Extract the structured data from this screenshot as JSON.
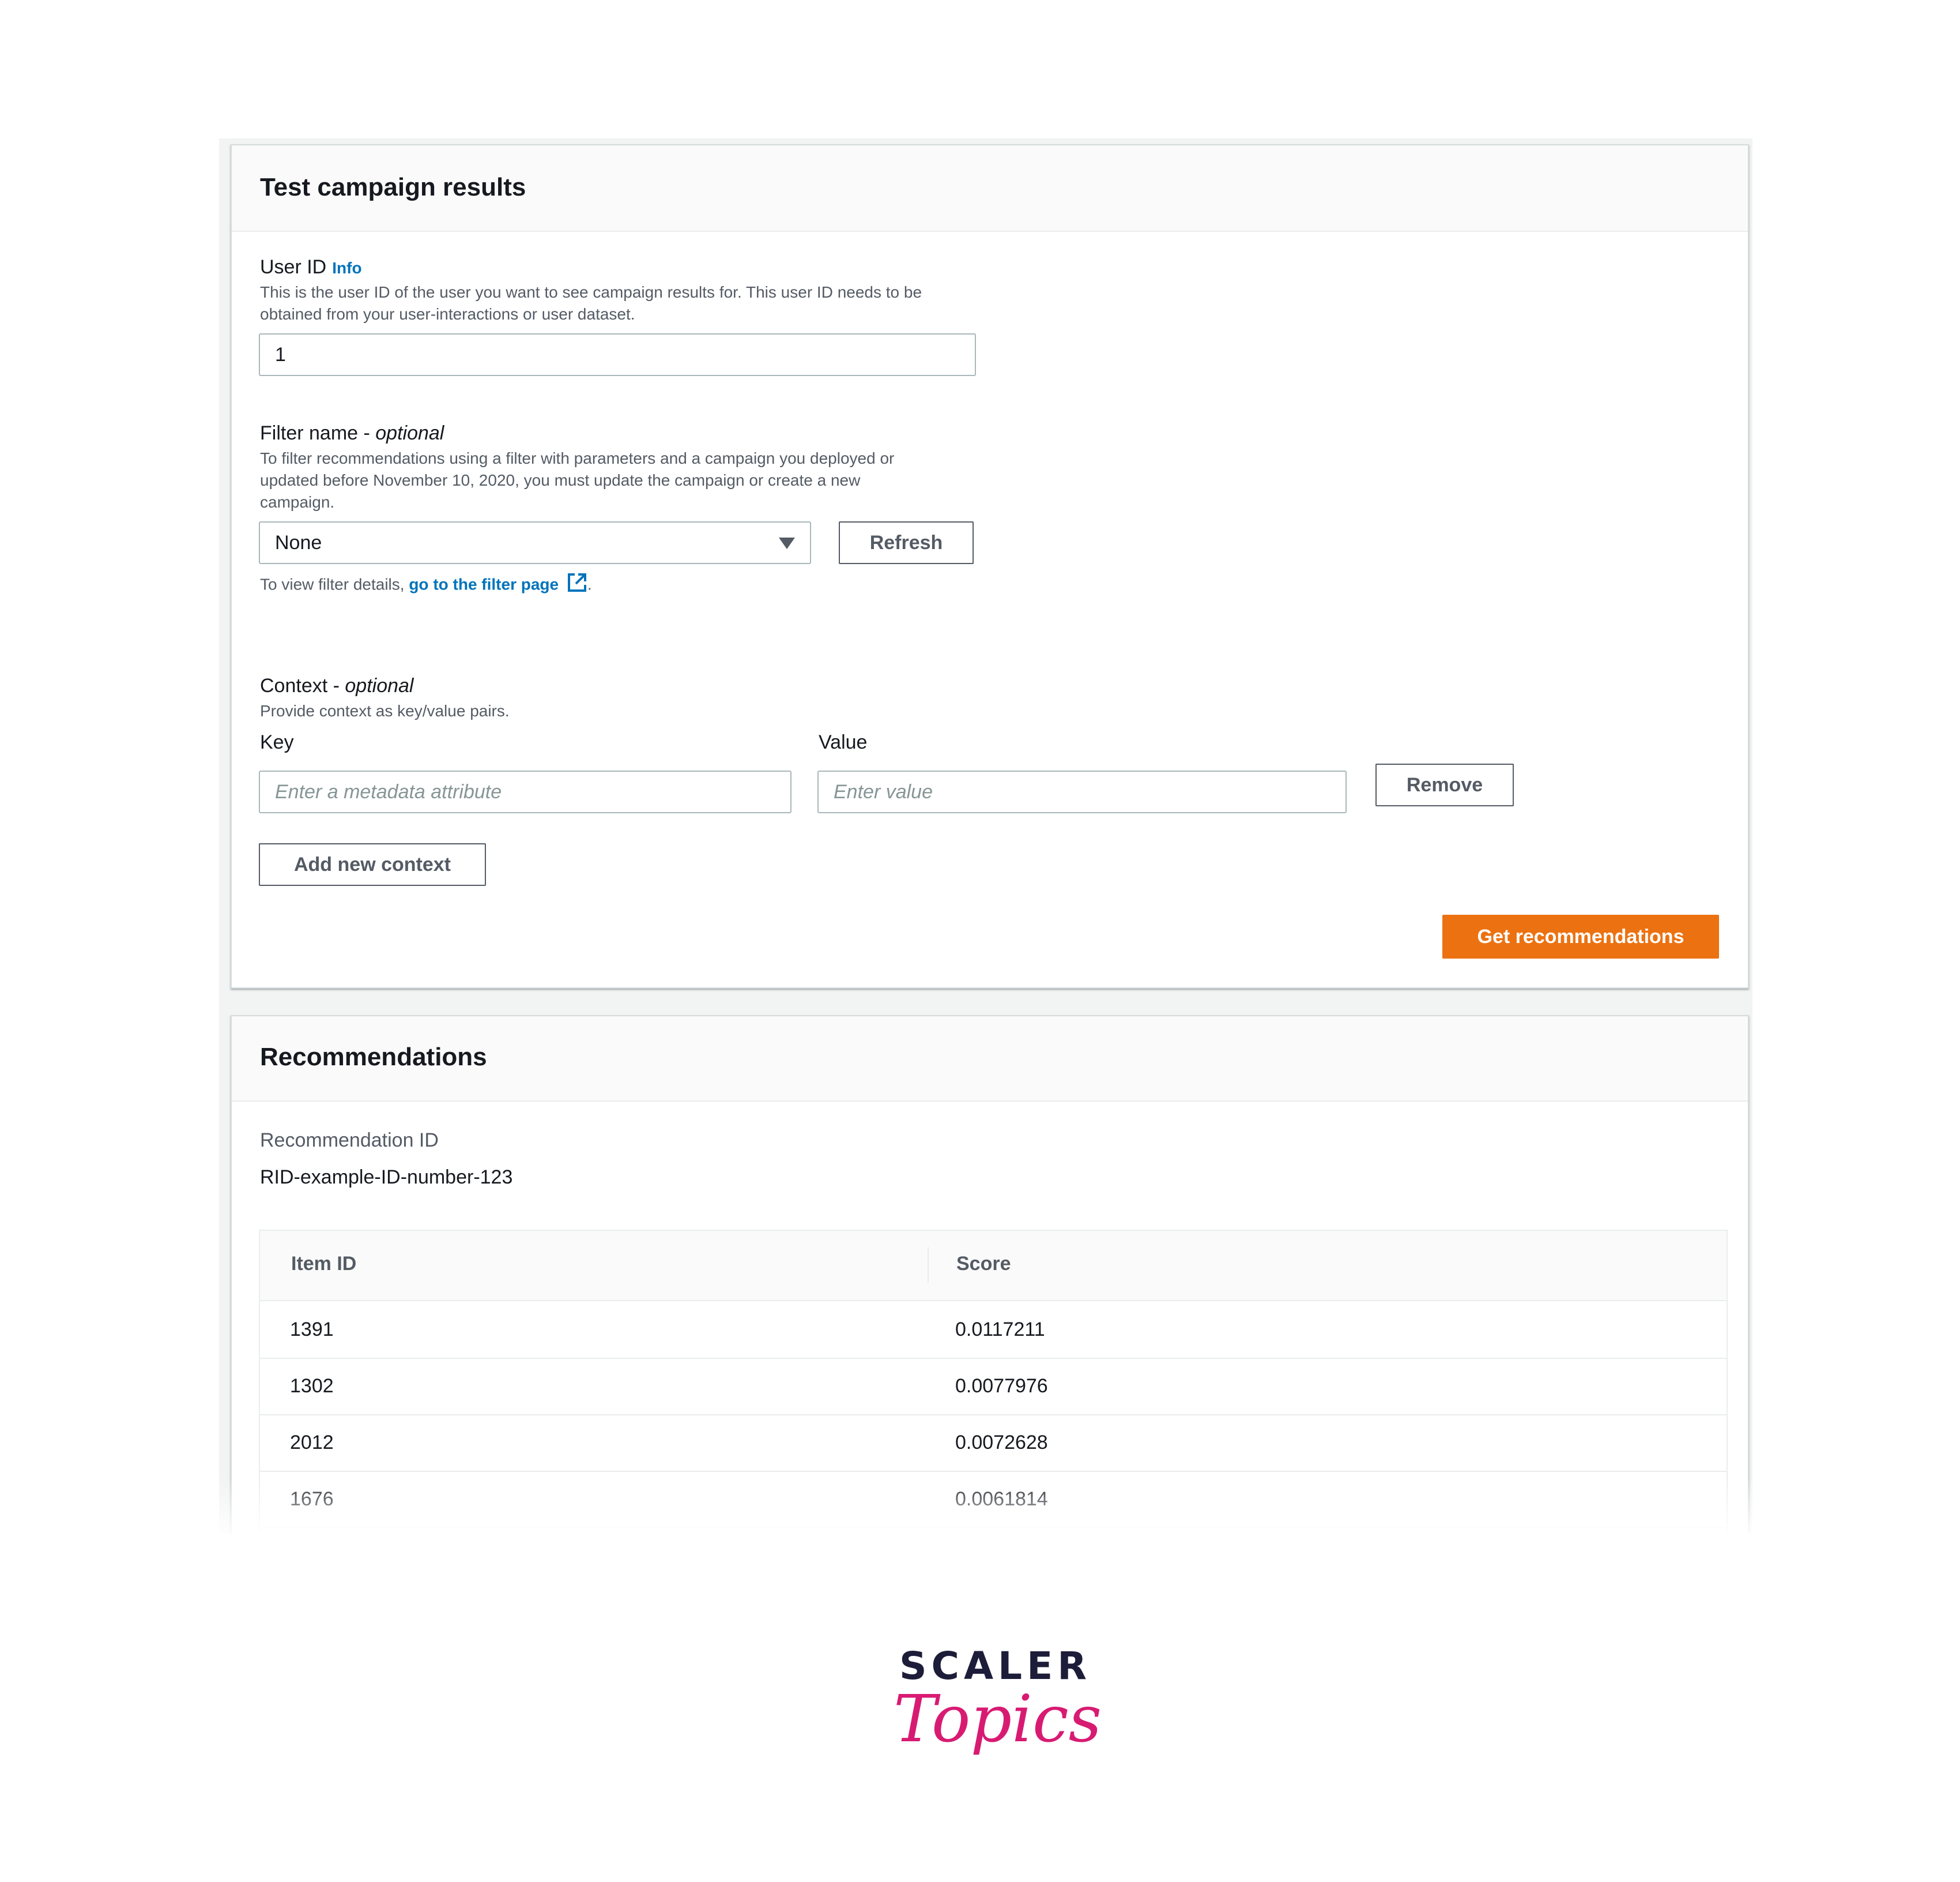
{
  "test_panel": {
    "title": "Test campaign results",
    "user_id": {
      "label": "User ID",
      "info_link": "Info",
      "description_line1": "This is the user ID of the user you want to see campaign results for. This user ID needs to be",
      "description_line2": "obtained from your user-interactions or user dataset.",
      "value": "1"
    },
    "filter": {
      "label": "Filter name - ",
      "optional": "optional",
      "description_line1": "To filter recommendations using a filter with parameters and a campaign you deployed or",
      "description_line2": "updated before November 10, 2020, you must update the campaign or create a new",
      "description_line3": "campaign.",
      "selected": "None",
      "refresh_label": "Refresh",
      "details_prefix": "To view filter details, ",
      "details_link": "go to the filter page",
      "details_suffix": "."
    },
    "context": {
      "label": "Context - ",
      "optional": "optional",
      "description": "Provide context as key/value pairs.",
      "key_label": "Key",
      "value_label": "Value",
      "key_placeholder": "Enter a metadata attribute",
      "value_placeholder": "Enter value",
      "remove_label": "Remove",
      "add_label": "Add new context"
    },
    "get_recommendations_label": "Get recommendations",
    "accent_color": "#ec7211",
    "link_color": "#0073bb"
  },
  "recommendations_panel": {
    "title": "Recommendations",
    "rec_id_label": "Recommendation ID",
    "rec_id_value": "RID-example-ID-number-123",
    "columns": [
      "Item ID",
      "Score"
    ],
    "rows": [
      {
        "item_id": "1391",
        "score": "0.0117211"
      },
      {
        "item_id": "1302",
        "score": "0.0077976"
      },
      {
        "item_id": "2012",
        "score": "0.0072628"
      },
      {
        "item_id": "1676",
        "score": "0.0061814"
      }
    ]
  },
  "branding": {
    "line1": "SCALER",
    "line2": "Topics"
  }
}
